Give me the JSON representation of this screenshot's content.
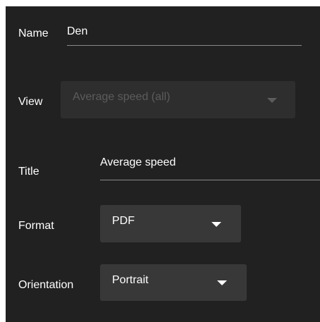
{
  "form": {
    "name": {
      "label": "Name",
      "value": "Den"
    },
    "view": {
      "label": "View",
      "value": "Average speed (all)",
      "disabled": true
    },
    "title": {
      "label": "Title",
      "value": "Average speed"
    },
    "format": {
      "label": "Format",
      "value": "PDF"
    },
    "orientation": {
      "label": "Orientation",
      "value": "Portrait"
    }
  },
  "icons": {
    "dropdown": "caret-down-icon"
  },
  "colors": {
    "panel_background": "#212121",
    "select_background": "#383838",
    "disabled_select_background": "#2e2e2e",
    "disabled_text": "#5c5c5c",
    "text": "#ffffff",
    "underline": "#8a8a8a"
  }
}
